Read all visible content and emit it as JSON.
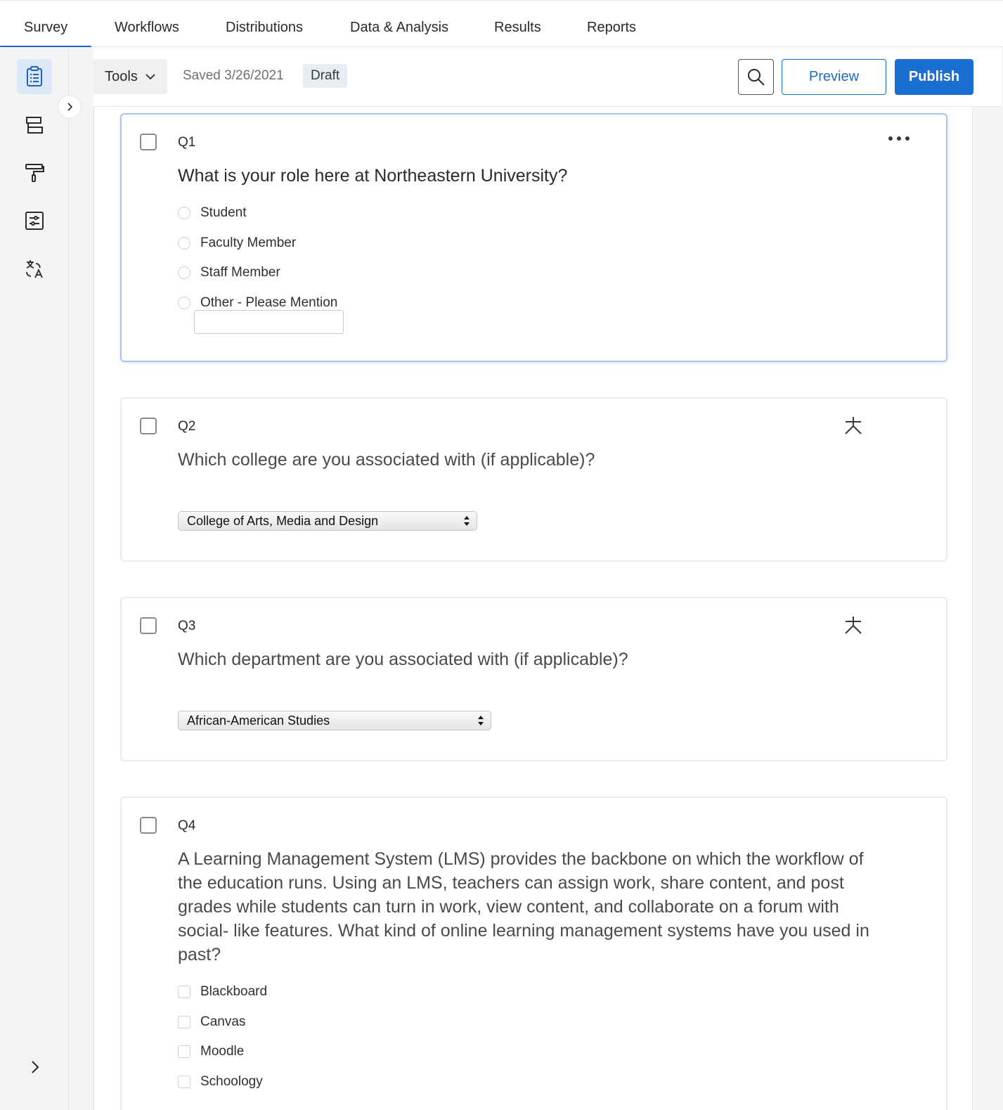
{
  "topnav": {
    "tabs": [
      {
        "label": "Survey"
      },
      {
        "label": "Workflows"
      },
      {
        "label": "Distributions"
      },
      {
        "label": "Data & Analysis"
      },
      {
        "label": "Results"
      },
      {
        "label": "Reports"
      }
    ]
  },
  "sidebar": {
    "items": [
      {
        "icon": "survey-clipboard-icon"
      },
      {
        "icon": "survey-flow-icon"
      },
      {
        "icon": "look-and-feel-paint-roller-icon"
      },
      {
        "icon": "survey-options-icon"
      },
      {
        "icon": "translate-icon"
      }
    ]
  },
  "toolbar": {
    "tools_label": "Tools",
    "saved_text": "Saved 3/26/2021",
    "status_badge": "Draft",
    "preview_label": "Preview",
    "publish_label": "Publish"
  },
  "questions": [
    {
      "number": "Q1",
      "text": "What is your role here at Northeastern University?",
      "options": [
        "Student",
        "Faculty Member",
        "Staff Member",
        "Other - Please Mention"
      ],
      "other_text_value": ""
    },
    {
      "number": "Q2",
      "text": "Which college are you associated with (if applicable)?",
      "selected_value": "College of Arts, Media and Design"
    },
    {
      "number": "Q3",
      "text": "Which department are you associated with (if applicable)?",
      "selected_value": "African-American Studies"
    },
    {
      "number": "Q4",
      "text": "A Learning Management System (LMS) provides the backbone on which the workflow of the education runs. Using an LMS, teachers can assign work, share content, and post grades while students can turn in work, view content, and collaborate on a forum with social- like features. What kind of online learning management systems have you used in past?",
      "options": [
        "Blackboard",
        "Canvas",
        "Moodle",
        "Schoology"
      ]
    }
  ],
  "colors": {
    "accent": "#1a6fd1",
    "tab_underline": "#1f5fbf",
    "selected_border": "#a9c8e8"
  }
}
